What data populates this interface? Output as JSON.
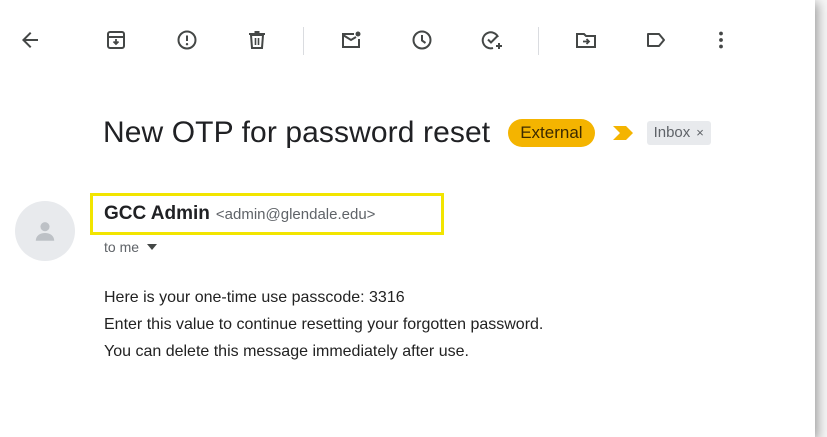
{
  "toolbar": {
    "back": "arrow-back-icon",
    "buttons": [
      "archive-icon",
      "report-spam-icon",
      "delete-icon",
      "mark-unread-icon",
      "snooze-icon",
      "add-to-tasks-icon",
      "move-to-icon",
      "labels-icon",
      "more-options-icon"
    ]
  },
  "message": {
    "subject": "New OTP for password reset",
    "labels": {
      "external": "External",
      "inbox": "Inbox",
      "inbox_remove": "×"
    },
    "sender": {
      "name": "GCC Admin",
      "email": "<admin@glendale.edu>"
    },
    "recipient": "to me",
    "body": [
      "Here is your one-time use passcode: 3316",
      "Enter this value to continue resetting your forgotten password.",
      "You can delete this message immediately after use."
    ]
  },
  "colors": {
    "external_label": "#f4b400",
    "highlight_box": "#f2e500",
    "important_marker": "#f4b400"
  }
}
